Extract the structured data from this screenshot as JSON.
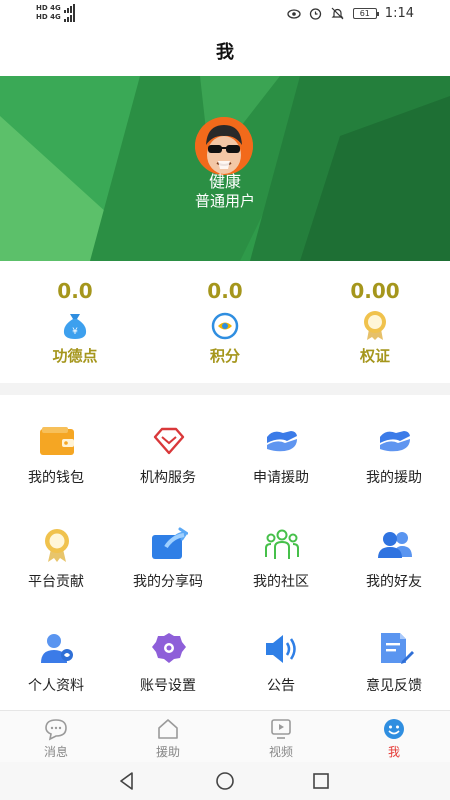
{
  "status_bar": {
    "left_line1": "HD 4G",
    "left_line2": "HD 4G",
    "battery": "61",
    "time": "1:14",
    "icons": [
      "eye-icon",
      "alarm-icon",
      "mute-icon",
      "battery-icon"
    ]
  },
  "header": {
    "title": "我"
  },
  "profile": {
    "name": "健康",
    "role": "普通用户"
  },
  "stats": [
    {
      "value": "0.0",
      "label": "功德点",
      "icon": "money-bag-icon"
    },
    {
      "value": "0.0",
      "label": "积分",
      "icon": "points-icon"
    },
    {
      "value": "0.00",
      "label": "权证",
      "icon": "badge-icon"
    }
  ],
  "menu": [
    {
      "label": "我的钱包",
      "icon": "wallet-icon"
    },
    {
      "label": "机构服务",
      "icon": "diamond-icon"
    },
    {
      "label": "申请援助",
      "icon": "handshake-icon"
    },
    {
      "label": "我的援助",
      "icon": "handshake-icon"
    },
    {
      "label": "平台贡献",
      "icon": "medal-icon"
    },
    {
      "label": "我的分享码",
      "icon": "share-icon"
    },
    {
      "label": "我的社区",
      "icon": "community-icon"
    },
    {
      "label": "我的好友",
      "icon": "friends-icon"
    },
    {
      "label": "个人资料",
      "icon": "profile-icon"
    },
    {
      "label": "账号设置",
      "icon": "gear-icon"
    },
    {
      "label": "公告",
      "icon": "speaker-icon"
    },
    {
      "label": "意见反馈",
      "icon": "feedback-icon"
    }
  ],
  "tabs": [
    {
      "label": "消息",
      "icon": "message-icon",
      "active": false
    },
    {
      "label": "援助",
      "icon": "home-icon",
      "active": false
    },
    {
      "label": "视频",
      "icon": "video-icon",
      "active": false
    },
    {
      "label": "我",
      "icon": "me-icon",
      "active": true
    }
  ],
  "colors": {
    "accent_gold": "#a5961c",
    "banner_green": "#2e9a48",
    "icon_blue": "#3b7be8",
    "active_tab": "#e53935"
  }
}
